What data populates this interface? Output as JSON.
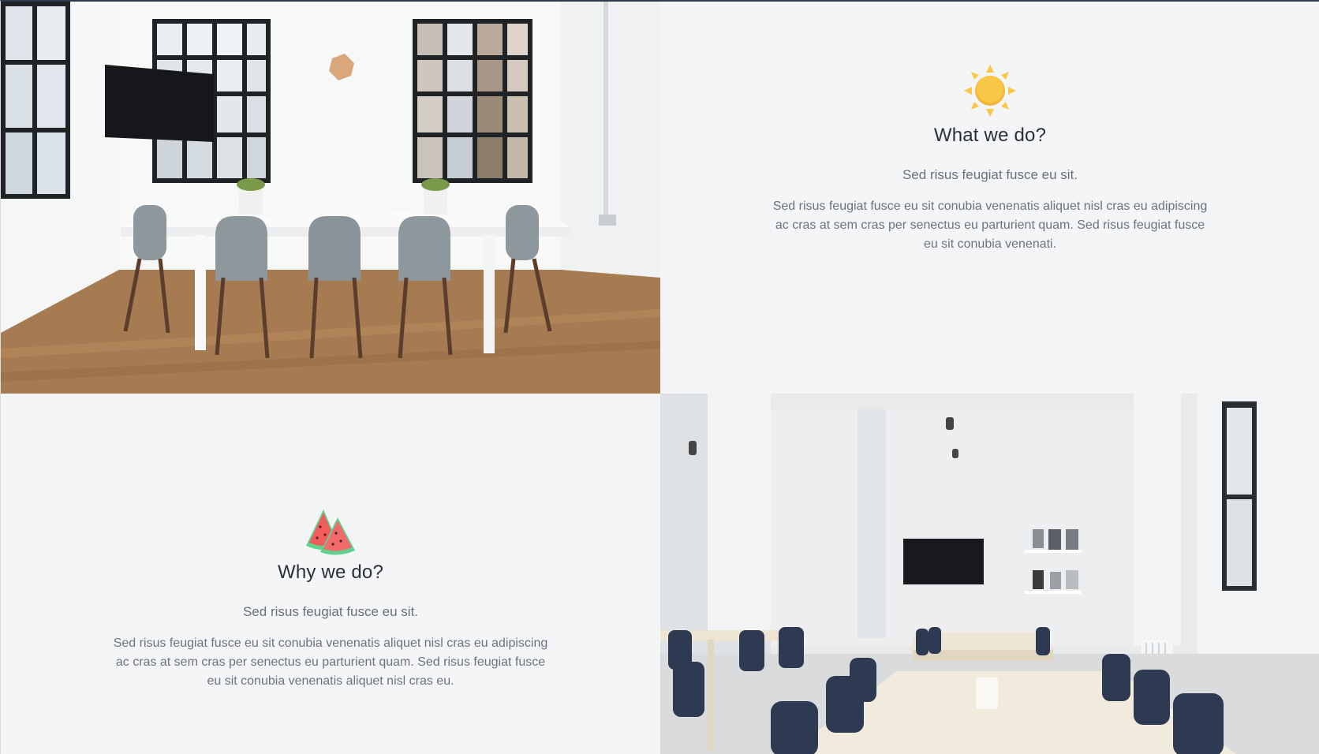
{
  "sections": {
    "what": {
      "icon": "sun-icon",
      "title": "What we do?",
      "subtitle": "Sed risus feugiat fusce eu sit.",
      "body": "Sed risus feugiat fusce eu sit conubia venenatis aliquet nisl cras eu adipiscing ac cras at sem cras per senectus eu parturient quam. Sed risus feugiat fusce eu sit conubia venenati."
    },
    "why": {
      "icon": "watermelon-icon",
      "title": "Why we do?",
      "subtitle": "Sed risus feugiat fusce eu sit.",
      "body": "Sed risus feugiat fusce eu sit conubia venenatis aliquet nisl cras eu adipiscing ac cras at sem cras per senectus eu parturient quam. Sed risus feugiat fusce eu sit conubia venenatis aliquet nisl cras eu."
    }
  },
  "colors": {
    "background": "#f4f5f7",
    "sun": "#f9c846",
    "watermelon_flesh": "#f25c5c",
    "watermelon_rind": "#5fd38d",
    "wood_floor": "#a77b52",
    "chair_gray": "#8e979c",
    "chair_navy": "#2d3a52"
  }
}
